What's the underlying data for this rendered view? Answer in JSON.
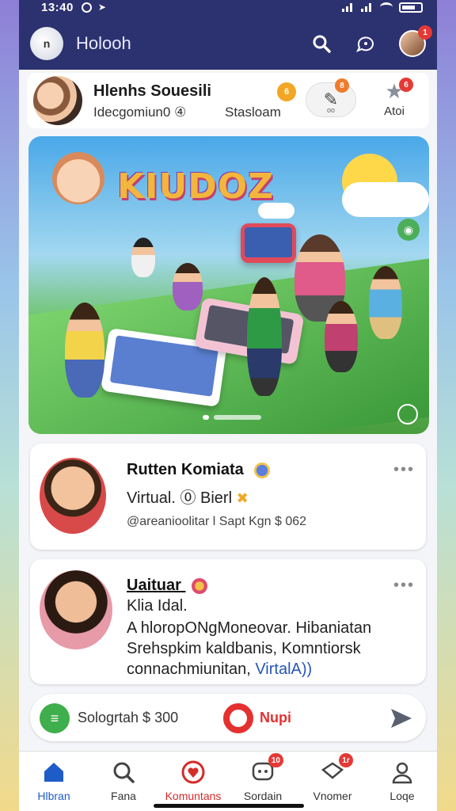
{
  "status": {
    "time": "13:40"
  },
  "header": {
    "logo_text": "n",
    "title": "Holooh"
  },
  "profile": {
    "name": "Hlenhs Souesili",
    "subtitle": "Idecgomiun0 ④",
    "subtitle2": "Stasloam",
    "coin_label": "6",
    "button_badge": "8",
    "button_caption": "oo",
    "star_badge": "6",
    "star_label": "Atoi"
  },
  "hero": {
    "title": "KIUDOZ"
  },
  "posts": [
    {
      "name": "Rutten Komiata",
      "line1": "Virtual. ⓪ Bierl",
      "meta": "@areanioolitar l Sapt Kgn $ 062"
    },
    {
      "name": "Uaituar",
      "line1": "Klia Idal.",
      "line2": "A hloropONgMoneovar. Hibaniatan",
      "line3": "Srehspkim kaldbanis, Komntiorsk",
      "line4_pre": "connachmiunitan, ",
      "line4_link": "VirtalA))"
    }
  ],
  "composer": {
    "left_text": "Sologrtah $ 300",
    "right_label": "Nupi"
  },
  "bottom_nav": [
    {
      "label": "Hlbran",
      "icon": "home-icon"
    },
    {
      "label": "Fana",
      "icon": "search-icon"
    },
    {
      "label": "Komuntans",
      "icon": "heart-icon"
    },
    {
      "label": "Sordain",
      "icon": "chat-icon",
      "badge": "10"
    },
    {
      "label": "Vnomer",
      "icon": "message-icon",
      "badge": "1r"
    },
    {
      "label": "Loqe",
      "icon": "profile-icon"
    }
  ],
  "header_badge": "1",
  "colors": {
    "header_bg": "#2c3170",
    "accent": "#1e5cc8",
    "red": "#e53935"
  }
}
